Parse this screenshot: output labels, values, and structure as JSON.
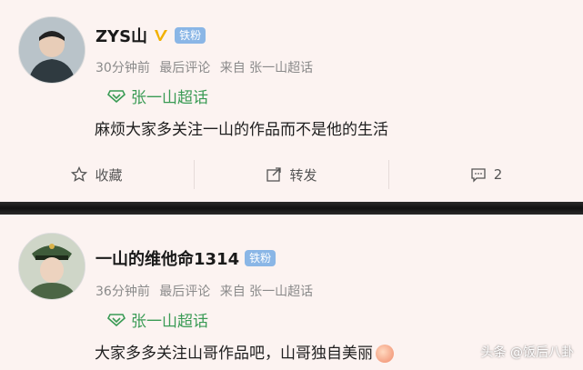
{
  "posts": [
    {
      "username": "ZYS山",
      "fan_badge": "铁粉",
      "time": "30分钟前",
      "comment_type": "最后评论",
      "source": "来自 张一山超话",
      "topic": "张一山超话",
      "content": "麻烦大家多关注一山的作品而不是他的生活",
      "actions": {
        "favorite": "收藏",
        "repost": "转发",
        "comments": "2"
      }
    },
    {
      "username": "一山的维他命1314",
      "fan_badge": "铁粉",
      "time": "36分钟前",
      "comment_type": "最后评论",
      "source": "来自 张一山超话",
      "topic": "张一山超话",
      "content": "大家多多关注山哥作品吧，山哥独自美丽"
    }
  ],
  "watermark": "头条 @饭后八卦",
  "colors": {
    "background": "#fcf3f1",
    "topic_green": "#3a9b55",
    "fan_badge": "#8ab6e6",
    "verified_gold": "#f2b100"
  }
}
